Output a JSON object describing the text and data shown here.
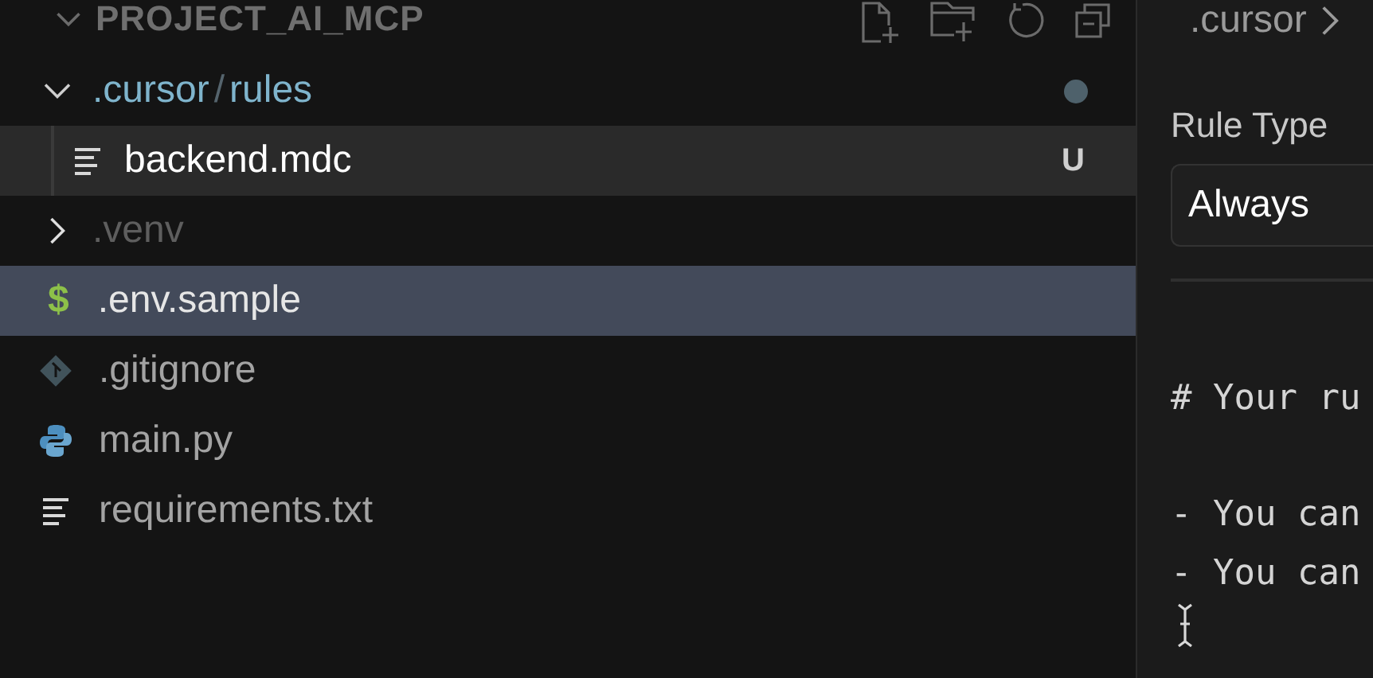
{
  "explorer": {
    "title": "PROJECT_AI_MCP",
    "expanded": true,
    "tree": [
      {
        "kind": "folder",
        "path": [
          ".cursor",
          "rules"
        ],
        "separator": "/",
        "expanded": true,
        "modified": true,
        "selected": false,
        "children": [
          {
            "kind": "text_file",
            "label": "backend.mdc",
            "badge": "U",
            "focused": true,
            "selected": false
          }
        ]
      },
      {
        "kind": "folder",
        "path": [
          ".venv"
        ],
        "expanded": false,
        "dimmed": true,
        "selected": false
      },
      {
        "kind": "env_file",
        "icon_char": "$",
        "label": ".env.sample",
        "selected": true
      },
      {
        "kind": "git_file",
        "label": ".gitignore",
        "selected": false
      },
      {
        "kind": "python_file",
        "label": "main.py",
        "selected": false
      },
      {
        "kind": "text_file",
        "label": "requirements.txt",
        "selected": false
      }
    ]
  },
  "editor": {
    "breadcrumb": [
      ".cursor"
    ],
    "rule_type": {
      "label": "Rule Type",
      "value": "Always"
    },
    "lines": [
      {
        "kind": "text",
        "text": "# Your ru"
      },
      {
        "kind": "blank"
      },
      {
        "kind": "text",
        "text": "- You can"
      },
      {
        "kind": "text",
        "text": "- You can"
      }
    ]
  }
}
